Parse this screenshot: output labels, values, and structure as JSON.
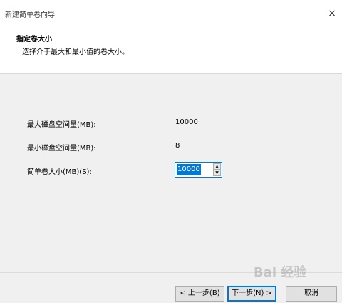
{
  "window": {
    "title": "新建简单卷向导",
    "close_glyph": "×"
  },
  "header": {
    "heading": "指定卷大小",
    "description": "选择介于最大和最小值的卷大小。"
  },
  "fields": {
    "max_label": "最大磁盘空间量(MB):",
    "max_value": "10000",
    "min_label": "最小磁盘空间量(MB):",
    "min_value": "8",
    "size_label": "简单卷大小(MB)(S):",
    "size_value": "10000"
  },
  "buttons": {
    "back": "< 上一步(B)",
    "next": "下一步(N) >",
    "cancel": "取消"
  },
  "watermark": "Bai 经验",
  "colors": {
    "accent": "#0078d7",
    "panel": "#f0f0f0"
  }
}
